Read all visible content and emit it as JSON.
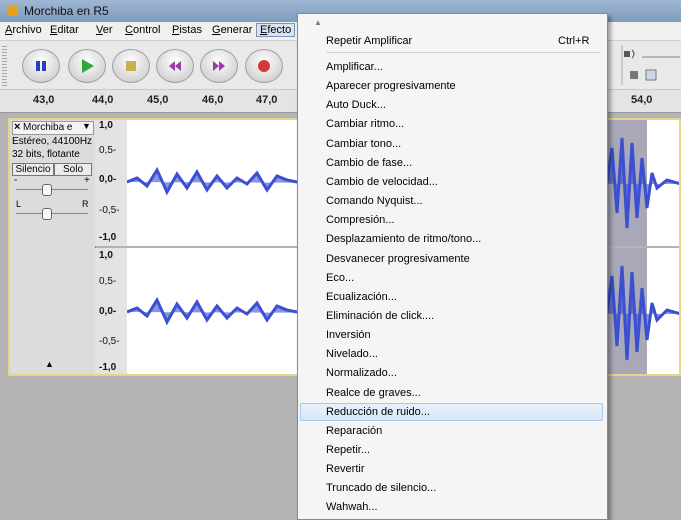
{
  "window": {
    "title": "Morchiba en R5"
  },
  "menubar": {
    "items": [
      "Archivo",
      "Editar",
      "Ver",
      "Control",
      "Pistas",
      "Generar",
      "Efecto"
    ]
  },
  "ruler": {
    "ticks": [
      "43,0",
      "44,0",
      "45,0",
      "46,0",
      "47,0",
      "54,0"
    ]
  },
  "track": {
    "name": "Morchiba e",
    "info_line1": "Estéreo, 44100Hz",
    "info_line2": "32 bits, flotante",
    "mute_label": "Silencio",
    "solo_label": "Solo",
    "gain_left": "-",
    "gain_right": "+",
    "pan_left": "L",
    "pan_right": "R",
    "collapse_arrow": "▲",
    "scale_top": [
      "1,0",
      "0,5-",
      "0,0-",
      "-0,5-",
      "-1,0"
    ],
    "scale_bottom": [
      "1,0",
      "0,5-",
      "0,0-",
      "-0,5-",
      "-1,0"
    ]
  },
  "effect_menu": {
    "repeat_label": "Repetir Amplificar",
    "repeat_shortcut": "Ctrl+R",
    "items": [
      "Amplificar...",
      "Aparecer progresivamente",
      "Auto Duck...",
      "Cambiar ritmo...",
      "Cambiar tono...",
      "Cambio de fase...",
      "Cambio de velocidad...",
      "Comando Nyquist...",
      "Compresión...",
      "Desplazamiento de ritmo/tono...",
      "Desvanecer progresivamente",
      "Eco...",
      "Ecualización...",
      "Eliminación de click....",
      "Inversión",
      "Nivelado...",
      "Normalizado...",
      "Realce de graves...",
      "Reducción de ruido...",
      "Reparación",
      "Repetir...",
      "Revertir",
      "Truncado de silencio...",
      "Wahwah..."
    ],
    "highlighted": "Reducción de ruido..."
  },
  "colors": {
    "waveform": "#3b4fd0",
    "selection": "#a8a8b8",
    "accent": "#d9e8f8"
  }
}
